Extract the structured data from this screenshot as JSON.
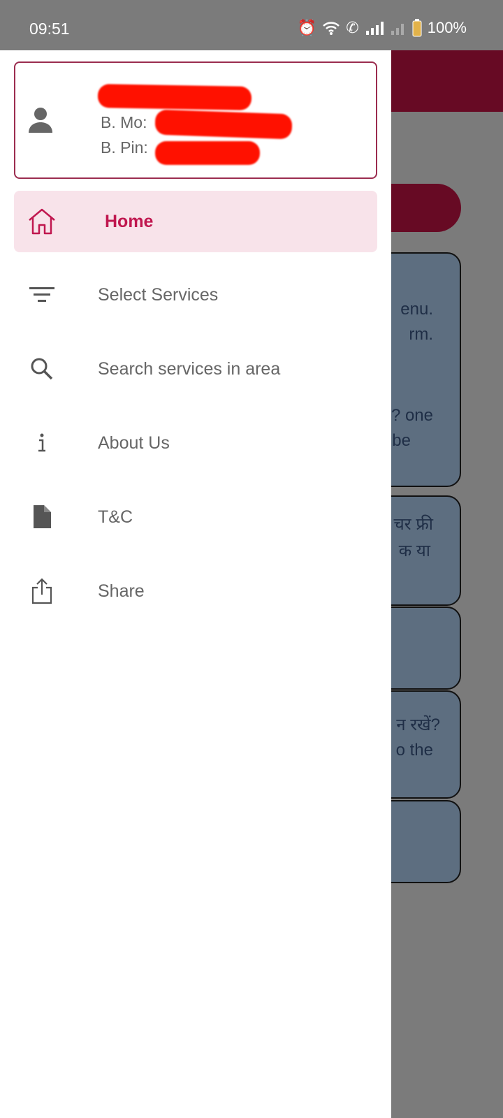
{
  "status_bar": {
    "time": "09:51",
    "battery": "100%"
  },
  "background": {
    "cards": [
      {
        "lines": [
          "enu.",
          "rm.",
          "",
          "? one",
          "be"
        ]
      },
      {
        "lines": [
          "चर फ्री",
          "क या"
        ]
      },
      {
        "lines": []
      },
      {
        "lines": [
          "न रखें?",
          "o the"
        ]
      },
      {
        "lines": []
      }
    ]
  },
  "drawer": {
    "header": {
      "mobile_label": "B. Mo:",
      "pin_label": "B. Pin:"
    },
    "items": [
      {
        "label": "Home",
        "icon": "home-icon",
        "active": true
      },
      {
        "label": "Select Services",
        "icon": "filter-icon"
      },
      {
        "label": "Search services in area",
        "icon": "search-icon"
      },
      {
        "label": "About Us",
        "icon": "info-icon"
      },
      {
        "label": "T&C",
        "icon": "document-icon"
      },
      {
        "label": "Share",
        "icon": "share-icon"
      }
    ]
  },
  "colors": {
    "accent": "#c0174f",
    "active_bg": "#f8e3ea",
    "appbar": "#670a24"
  }
}
